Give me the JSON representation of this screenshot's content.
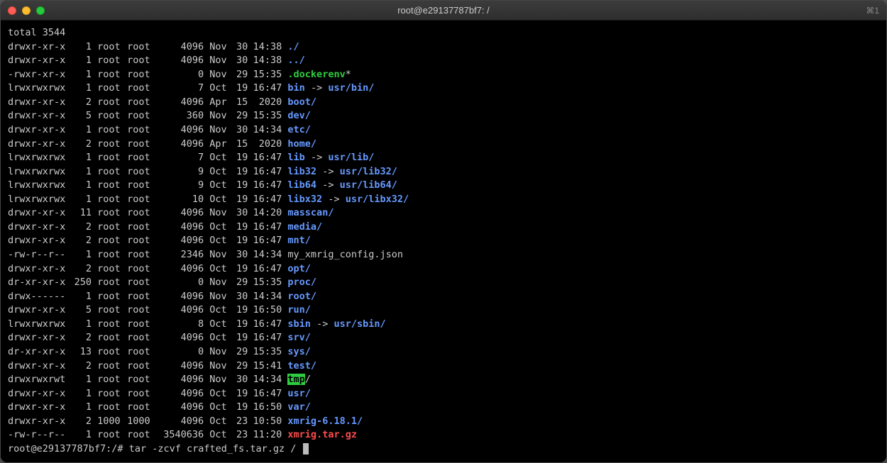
{
  "window": {
    "title": "root@e29137787bf7: /",
    "shortcut_hint": "⌘1"
  },
  "terminal": {
    "total_line": "total 3544",
    "rows": [
      {
        "perms": "drwxr-xr-x",
        "links": "1",
        "owner": "root",
        "group": "root",
        "size": "4096",
        "month": "Nov",
        "day": "30",
        "time": "14:38",
        "entries": [
          {
            "t": "./",
            "c": "blue"
          }
        ]
      },
      {
        "perms": "drwxr-xr-x",
        "links": "1",
        "owner": "root",
        "group": "root",
        "size": "4096",
        "month": "Nov",
        "day": "30",
        "time": "14:38",
        "entries": [
          {
            "t": "../",
            "c": "blue"
          }
        ]
      },
      {
        "perms": "-rwxr-xr-x",
        "links": "1",
        "owner": "root",
        "group": "root",
        "size": "0",
        "month": "Nov",
        "day": "29",
        "time": "15:35",
        "entries": [
          {
            "t": ".dockerenv",
            "c": "green"
          },
          {
            "t": "*",
            "c": "normal"
          }
        ]
      },
      {
        "perms": "lrwxrwxrwx",
        "links": "1",
        "owner": "root",
        "group": "root",
        "size": "7",
        "month": "Oct",
        "day": "19",
        "time": "16:47",
        "entries": [
          {
            "t": "bin",
            "c": "blue"
          },
          {
            "t": " -> ",
            "c": "arrow"
          },
          {
            "t": "usr/bin/",
            "c": "blue"
          }
        ]
      },
      {
        "perms": "drwxr-xr-x",
        "links": "2",
        "owner": "root",
        "group": "root",
        "size": "4096",
        "month": "Apr",
        "day": "15",
        "time": " 2020",
        "entries": [
          {
            "t": "boot/",
            "c": "blue"
          }
        ]
      },
      {
        "perms": "drwxr-xr-x",
        "links": "5",
        "owner": "root",
        "group": "root",
        "size": "360",
        "month": "Nov",
        "day": "29",
        "time": "15:35",
        "entries": [
          {
            "t": "dev/",
            "c": "blue"
          }
        ]
      },
      {
        "perms": "drwxr-xr-x",
        "links": "1",
        "owner": "root",
        "group": "root",
        "size": "4096",
        "month": "Nov",
        "day": "30",
        "time": "14:34",
        "entries": [
          {
            "t": "etc/",
            "c": "blue"
          }
        ]
      },
      {
        "perms": "drwxr-xr-x",
        "links": "2",
        "owner": "root",
        "group": "root",
        "size": "4096",
        "month": "Apr",
        "day": "15",
        "time": " 2020",
        "entries": [
          {
            "t": "home/",
            "c": "blue"
          }
        ]
      },
      {
        "perms": "lrwxrwxrwx",
        "links": "1",
        "owner": "root",
        "group": "root",
        "size": "7",
        "month": "Oct",
        "day": "19",
        "time": "16:47",
        "entries": [
          {
            "t": "lib",
            "c": "blue"
          },
          {
            "t": " -> ",
            "c": "arrow"
          },
          {
            "t": "usr/lib/",
            "c": "blue"
          }
        ]
      },
      {
        "perms": "lrwxrwxrwx",
        "links": "1",
        "owner": "root",
        "group": "root",
        "size": "9",
        "month": "Oct",
        "day": "19",
        "time": "16:47",
        "entries": [
          {
            "t": "lib32",
            "c": "blue"
          },
          {
            "t": " -> ",
            "c": "arrow"
          },
          {
            "t": "usr/lib32/",
            "c": "blue"
          }
        ]
      },
      {
        "perms": "lrwxrwxrwx",
        "links": "1",
        "owner": "root",
        "group": "root",
        "size": "9",
        "month": "Oct",
        "day": "19",
        "time": "16:47",
        "entries": [
          {
            "t": "lib64",
            "c": "blue"
          },
          {
            "t": " -> ",
            "c": "arrow"
          },
          {
            "t": "usr/lib64/",
            "c": "blue"
          }
        ]
      },
      {
        "perms": "lrwxrwxrwx",
        "links": "1",
        "owner": "root",
        "group": "root",
        "size": "10",
        "month": "Oct",
        "day": "19",
        "time": "16:47",
        "entries": [
          {
            "t": "libx32",
            "c": "blue"
          },
          {
            "t": " -> ",
            "c": "arrow"
          },
          {
            "t": "usr/libx32/",
            "c": "blue"
          }
        ]
      },
      {
        "perms": "drwxr-xr-x",
        "links": "11",
        "owner": "root",
        "group": "root",
        "size": "4096",
        "month": "Nov",
        "day": "30",
        "time": "14:20",
        "entries": [
          {
            "t": "masscan/",
            "c": "blue"
          }
        ]
      },
      {
        "perms": "drwxr-xr-x",
        "links": "2",
        "owner": "root",
        "group": "root",
        "size": "4096",
        "month": "Oct",
        "day": "19",
        "time": "16:47",
        "entries": [
          {
            "t": "media/",
            "c": "blue"
          }
        ]
      },
      {
        "perms": "drwxr-xr-x",
        "links": "2",
        "owner": "root",
        "group": "root",
        "size": "4096",
        "month": "Oct",
        "day": "19",
        "time": "16:47",
        "entries": [
          {
            "t": "mnt/",
            "c": "blue"
          }
        ]
      },
      {
        "perms": "-rw-r--r--",
        "links": "1",
        "owner": "root",
        "group": "root",
        "size": "2346",
        "month": "Nov",
        "day": "30",
        "time": "14:34",
        "entries": [
          {
            "t": "my_xmrig_config.json",
            "c": "normal"
          }
        ]
      },
      {
        "perms": "drwxr-xr-x",
        "links": "2",
        "owner": "root",
        "group": "root",
        "size": "4096",
        "month": "Oct",
        "day": "19",
        "time": "16:47",
        "entries": [
          {
            "t": "opt/",
            "c": "blue"
          }
        ]
      },
      {
        "perms": "dr-xr-xr-x",
        "links": "250",
        "owner": "root",
        "group": "root",
        "size": "0",
        "month": "Nov",
        "day": "29",
        "time": "15:35",
        "entries": [
          {
            "t": "proc/",
            "c": "blue"
          }
        ]
      },
      {
        "perms": "drwx------",
        "links": "1",
        "owner": "root",
        "group": "root",
        "size": "4096",
        "month": "Nov",
        "day": "30",
        "time": "14:34",
        "entries": [
          {
            "t": "root/",
            "c": "blue"
          }
        ]
      },
      {
        "perms": "drwxr-xr-x",
        "links": "5",
        "owner": "root",
        "group": "root",
        "size": "4096",
        "month": "Oct",
        "day": "19",
        "time": "16:50",
        "entries": [
          {
            "t": "run/",
            "c": "blue"
          }
        ]
      },
      {
        "perms": "lrwxrwxrwx",
        "links": "1",
        "owner": "root",
        "group": "root",
        "size": "8",
        "month": "Oct",
        "day": "19",
        "time": "16:47",
        "entries": [
          {
            "t": "sbin",
            "c": "blue"
          },
          {
            "t": " -> ",
            "c": "arrow"
          },
          {
            "t": "usr/sbin/",
            "c": "blue"
          }
        ]
      },
      {
        "perms": "drwxr-xr-x",
        "links": "2",
        "owner": "root",
        "group": "root",
        "size": "4096",
        "month": "Oct",
        "day": "19",
        "time": "16:47",
        "entries": [
          {
            "t": "srv/",
            "c": "blue"
          }
        ]
      },
      {
        "perms": "dr-xr-xr-x",
        "links": "13",
        "owner": "root",
        "group": "root",
        "size": "0",
        "month": "Nov",
        "day": "29",
        "time": "15:35",
        "entries": [
          {
            "t": "sys/",
            "c": "blue"
          }
        ]
      },
      {
        "perms": "drwxr-xr-x",
        "links": "2",
        "owner": "root",
        "group": "root",
        "size": "4096",
        "month": "Nov",
        "day": "29",
        "time": "15:41",
        "entries": [
          {
            "t": "test/",
            "c": "blue"
          }
        ]
      },
      {
        "perms": "drwxrwxrwt",
        "links": "1",
        "owner": "root",
        "group": "root",
        "size": "4096",
        "month": "Nov",
        "day": "30",
        "time": "14:34",
        "entries": [
          {
            "t": "tmp",
            "c": "tmp"
          },
          {
            "t": "/",
            "c": "normal"
          }
        ]
      },
      {
        "perms": "drwxr-xr-x",
        "links": "1",
        "owner": "root",
        "group": "root",
        "size": "4096",
        "month": "Oct",
        "day": "19",
        "time": "16:47",
        "entries": [
          {
            "t": "usr/",
            "c": "blue"
          }
        ]
      },
      {
        "perms": "drwxr-xr-x",
        "links": "1",
        "owner": "root",
        "group": "root",
        "size": "4096",
        "month": "Oct",
        "day": "19",
        "time": "16:50",
        "entries": [
          {
            "t": "var/",
            "c": "blue"
          }
        ]
      },
      {
        "perms": "drwxr-xr-x",
        "links": "2",
        "owner": "1000",
        "group": "1000",
        "size": "4096",
        "month": "Oct",
        "day": "23",
        "time": "10:50",
        "entries": [
          {
            "t": "xmrig-6.18.1/",
            "c": "blue"
          }
        ]
      },
      {
        "perms": "-rw-r--r--",
        "links": "1",
        "owner": "root",
        "group": "root",
        "size": "3540636",
        "month": "Oct",
        "day": "23",
        "time": "11:20",
        "entries": [
          {
            "t": "xmrig.tar.gz",
            "c": "red"
          }
        ]
      }
    ],
    "prompt": "root@e29137787bf7:/# ",
    "command": "tar -zcvf crafted_fs.tar.gz / "
  }
}
